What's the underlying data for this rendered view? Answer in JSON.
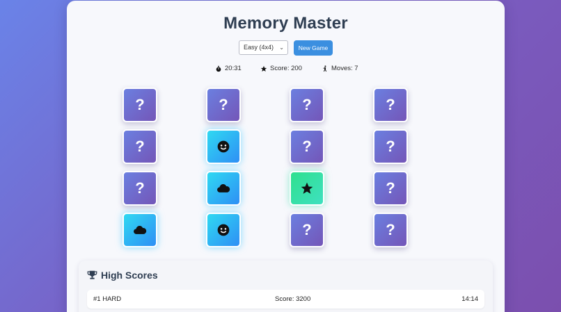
{
  "title": "Memory Master",
  "controls": {
    "difficulty_selected": "Easy (4x4)",
    "new_game_label": "New Game"
  },
  "stats": {
    "timer": "20:31",
    "score": "Score: 200",
    "moves": "Moves: 7"
  },
  "board": {
    "rows": 4,
    "cols": 4,
    "hidden_symbol": "?",
    "cards": [
      {
        "state": "hidden",
        "icon": ""
      },
      {
        "state": "hidden",
        "icon": ""
      },
      {
        "state": "hidden",
        "icon": ""
      },
      {
        "state": "hidden",
        "icon": ""
      },
      {
        "state": "hidden",
        "icon": ""
      },
      {
        "state": "matched",
        "icon": "smiley-icon"
      },
      {
        "state": "hidden",
        "icon": ""
      },
      {
        "state": "hidden",
        "icon": ""
      },
      {
        "state": "hidden",
        "icon": ""
      },
      {
        "state": "matched",
        "icon": "cloud-icon"
      },
      {
        "state": "flipped",
        "icon": "star-icon"
      },
      {
        "state": "hidden",
        "icon": ""
      },
      {
        "state": "matched",
        "icon": "cloud-icon"
      },
      {
        "state": "matched",
        "icon": "smiley-icon"
      },
      {
        "state": "hidden",
        "icon": ""
      },
      {
        "state": "hidden",
        "icon": ""
      }
    ]
  },
  "high_scores": {
    "title": "High Scores",
    "entries": [
      {
        "rank_level": "#1 HARD",
        "score": "Score: 3200",
        "time": "14:14"
      }
    ]
  },
  "colors": {
    "hidden_card": "#7060c8",
    "matched_card": "#2fc4f5",
    "flipped_card": "#34e0a8",
    "button": "#3b8fe0"
  }
}
